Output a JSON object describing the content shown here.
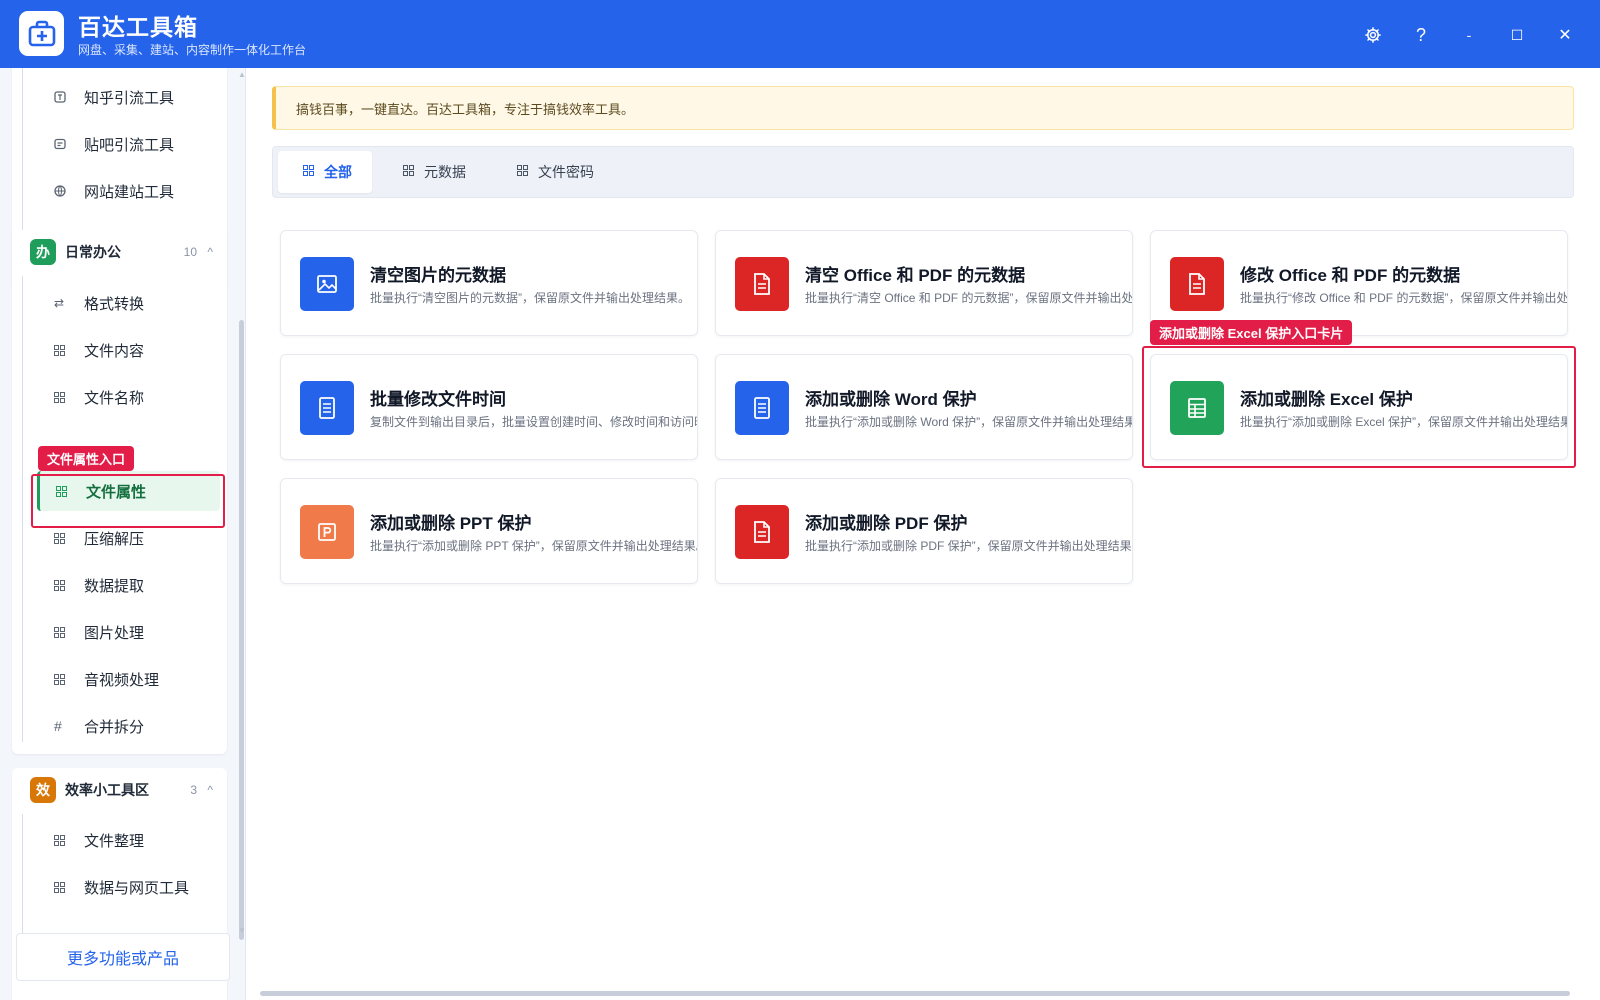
{
  "app": {
    "title": "百达工具箱",
    "subtitle": "网盘、采集、建站、内容制作一体化工作台",
    "brand_color": "#2563eb"
  },
  "window_controls": {
    "settings_icon": "gear-icon",
    "help_label": "?",
    "minimize_label": "-",
    "maximize_label": "☐",
    "close_label": "✕"
  },
  "sidebar": {
    "prev_group_items": [
      {
        "label": "知乎引流工具",
        "icon": "zhihu-icon"
      },
      {
        "label": "贴吧引流工具",
        "icon": "tieba-icon"
      },
      {
        "label": "网站建站工具",
        "icon": "website-icon"
      }
    ],
    "groups": [
      {
        "badge": "办",
        "badge_color": "#1f9d5a",
        "title": "日常办公",
        "count": "10",
        "chevron": "^",
        "items": [
          {
            "label": "格式转换",
            "icon": "swap-icon"
          },
          {
            "label": "文件内容",
            "icon": "grid-icon"
          },
          {
            "label": "文件名称",
            "icon": "grid-icon"
          },
          {
            "label": "文件属性",
            "icon": "grid-icon",
            "active": true
          },
          {
            "label": "压缩解压",
            "icon": "grid-icon"
          },
          {
            "label": "数据提取",
            "icon": "grid-icon"
          },
          {
            "label": "图片处理",
            "icon": "grid-icon"
          },
          {
            "label": "音视频处理",
            "icon": "grid-icon"
          },
          {
            "label": "合并拆分",
            "icon": "hash-icon"
          }
        ]
      },
      {
        "badge": "效",
        "badge_color": "#d97706",
        "title": "效率小工具区",
        "count": "3",
        "chevron": "^",
        "items": [
          {
            "label": "文件整理",
            "icon": "grid-icon"
          },
          {
            "label": "数据与网页工具",
            "icon": "grid-icon"
          }
        ]
      }
    ],
    "more_button": "更多功能或产品"
  },
  "annotations": {
    "sidebar_tag": "文件属性入口",
    "card_tag": "添加或删除 Excel 保护入口卡片",
    "highlight_color": "#e11d48"
  },
  "main": {
    "notice": "搞钱百事，一键直达。百达工具箱，专注于搞钱效率工具。",
    "tabs": [
      {
        "label": "全部",
        "active": true
      },
      {
        "label": "元数据",
        "active": false
      },
      {
        "label": "文件密码",
        "active": false
      }
    ],
    "cards": [
      {
        "title": "清空图片的元数据",
        "desc": "批量执行“清空图片的元数据”，保留原文件并输出处理结果。",
        "icon": "image-icon",
        "color": "#2563eb"
      },
      {
        "title": "清空 Office 和 PDF 的元数据",
        "desc": "批量执行“清空 Office 和 PDF 的元数据”，保留原文件并输出处理结果。",
        "icon": "document-icon",
        "color": "#dc2626"
      },
      {
        "title": "修改 Office 和 PDF 的元数据",
        "desc": "批量执行“修改 Office 和 PDF 的元数据”，保留原文件并输出处理结果。",
        "icon": "document-icon",
        "color": "#dc2626"
      },
      {
        "title": "批量修改文件时间",
        "desc": "复制文件到输出目录后，批量设置创建时间、修改时间和访问时间。",
        "icon": "document-lines-icon",
        "color": "#2563eb"
      },
      {
        "title": "添加或删除 Word 保护",
        "desc": "批量执行“添加或删除 Word 保护”，保留原文件并输出处理结果。",
        "icon": "document-lines-icon",
        "color": "#2563eb"
      },
      {
        "title": "添加或删除 Excel 保护",
        "desc": "批量执行“添加或删除 Excel 保护”，保留原文件并输出处理结果。",
        "icon": "spreadsheet-icon",
        "color": "#22a35a"
      },
      {
        "title": "添加或删除 PPT 保护",
        "desc": "批量执行“添加或删除 PPT 保护”，保留原文件并输出处理结果。",
        "icon": "presentation-icon",
        "color": "#f07a4a"
      },
      {
        "title": "添加或删除 PDF 保护",
        "desc": "批量执行“添加或删除 PDF 保护”，保留原文件并输出处理结果。",
        "icon": "document-icon",
        "color": "#dc2626"
      }
    ]
  }
}
